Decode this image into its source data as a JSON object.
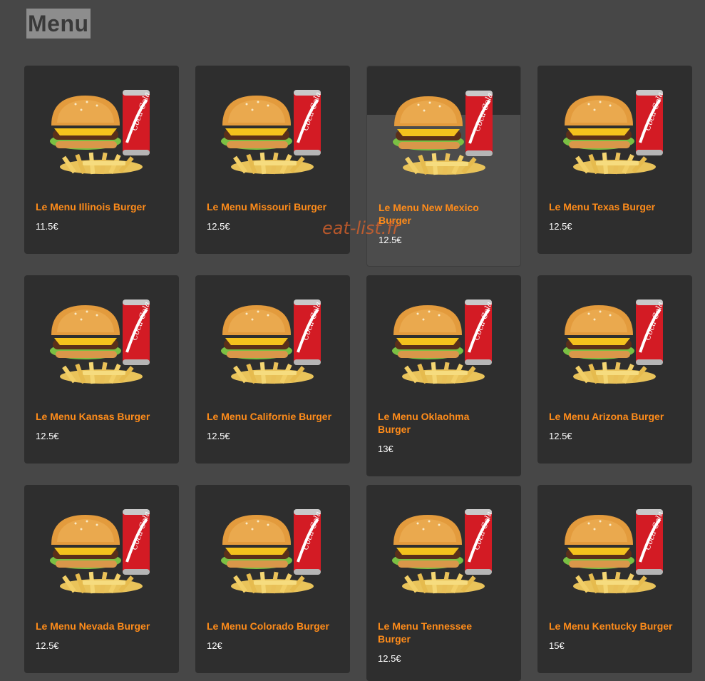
{
  "page": {
    "title": "Menu",
    "watermark": "eat-list.fr"
  },
  "menu_items": [
    {
      "name": "Le Menu Illinois Burger",
      "price": "11.5€"
    },
    {
      "name": "Le Menu Missouri Burger",
      "price": "12.5€"
    },
    {
      "name": "Le Menu New Mexico Burger",
      "price": "12.5€"
    },
    {
      "name": "Le Menu Texas Burger",
      "price": "12.5€"
    },
    {
      "name": "Le Menu Kansas Burger",
      "price": "12.5€"
    },
    {
      "name": "Le Menu Californie Burger",
      "price": "12.5€"
    },
    {
      "name": "Le Menu Oklaohma Burger",
      "price": "13€"
    },
    {
      "name": "Le Menu Arizona Burger",
      "price": "12.5€"
    },
    {
      "name": "Le Menu Nevada Burger",
      "price": "12.5€"
    },
    {
      "name": "Le Menu Colorado Burger",
      "price": "12€"
    },
    {
      "name": "Le Menu Tennessee Burger",
      "price": "12.5€"
    },
    {
      "name": "Le Menu Kentucky Burger",
      "price": "15€"
    }
  ],
  "colors": {
    "background": "#474747",
    "card": "#2e2e2e",
    "item_name": "#ff8c1a",
    "price": "#ffffff",
    "watermark": "#d9622b"
  },
  "image_labels": {
    "can": "Coca-Cola"
  },
  "icons": [
    "burger-image",
    "fries-image",
    "soda-can-image"
  ]
}
